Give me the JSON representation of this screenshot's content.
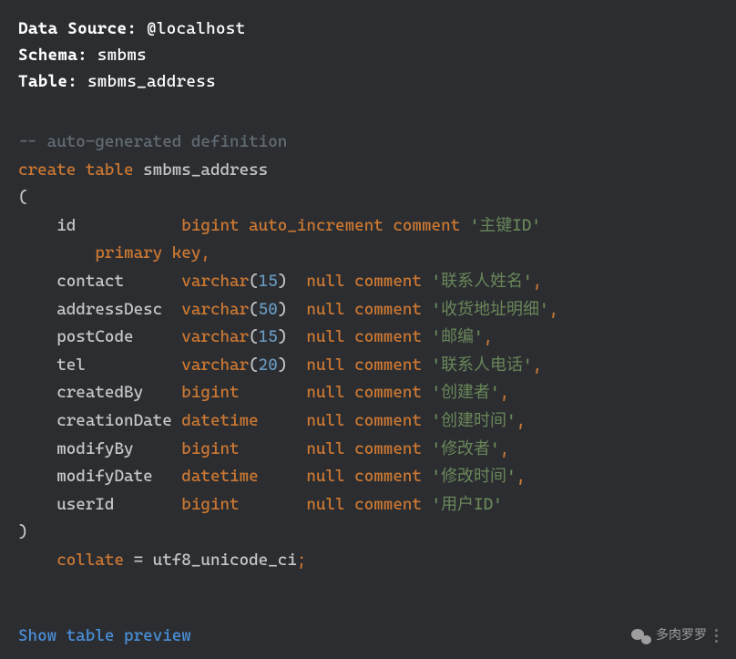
{
  "header": {
    "dataSourceLabel": "Data Source:",
    "dataSourceValue": "@localhost",
    "schemaLabel": "Schema:",
    "schemaValue": "smbms",
    "tableLabel": "Table:",
    "tableValue": "smbms_address"
  },
  "sql": {
    "comment": "-- auto-generated definition",
    "create": "create",
    "table_kw": "table",
    "tableName": "smbms_address",
    "open": "(",
    "close": ")",
    "columns": [
      {
        "name": "id",
        "type": "bigint",
        "extra": "auto_increment",
        "nullable": "",
        "comment_kw": "comment",
        "comment": "'主键ID'",
        "trail": ""
      },
      {
        "primary": "primary key,",
        "indent": true
      },
      {
        "name": "contact",
        "type": "varchar",
        "size": "15",
        "nullable": "null",
        "comment_kw": "comment",
        "comment": "'联系人姓名'",
        "trail": ","
      },
      {
        "name": "addressDesc",
        "type": "varchar",
        "size": "50",
        "nullable": "null",
        "comment_kw": "comment",
        "comment": "'收货地址明细'",
        "trail": ","
      },
      {
        "name": "postCode",
        "type": "varchar",
        "size": "15",
        "nullable": "null",
        "comment_kw": "comment",
        "comment": "'邮编'",
        "trail": ","
      },
      {
        "name": "tel",
        "type": "varchar",
        "size": "20",
        "nullable": "null",
        "comment_kw": "comment",
        "comment": "'联系人电话'",
        "trail": ","
      },
      {
        "name": "createdBy",
        "type": "bigint",
        "nullable": "null",
        "comment_kw": "comment",
        "comment": "'创建者'",
        "trail": ","
      },
      {
        "name": "creationDate",
        "type": "datetime",
        "nullable": "null",
        "comment_kw": "comment",
        "comment": "'创建时间'",
        "trail": ","
      },
      {
        "name": "modifyBy",
        "type": "bigint",
        "nullable": "null",
        "comment_kw": "comment",
        "comment": "'修改者'",
        "trail": ","
      },
      {
        "name": "modifyDate",
        "type": "datetime",
        "nullable": "null",
        "comment_kw": "comment",
        "comment": "'修改时间'",
        "trail": ","
      },
      {
        "name": "userId",
        "type": "bigint",
        "nullable": "null",
        "comment_kw": "comment",
        "comment": "'用户ID'",
        "trail": ""
      }
    ],
    "collate_kw": "collate",
    "equals": "=",
    "collate_val": "utf8_unicode_ci",
    "semi": ";"
  },
  "footer": {
    "linkText": "Show table preview",
    "watermark": "多肉罗罗"
  }
}
